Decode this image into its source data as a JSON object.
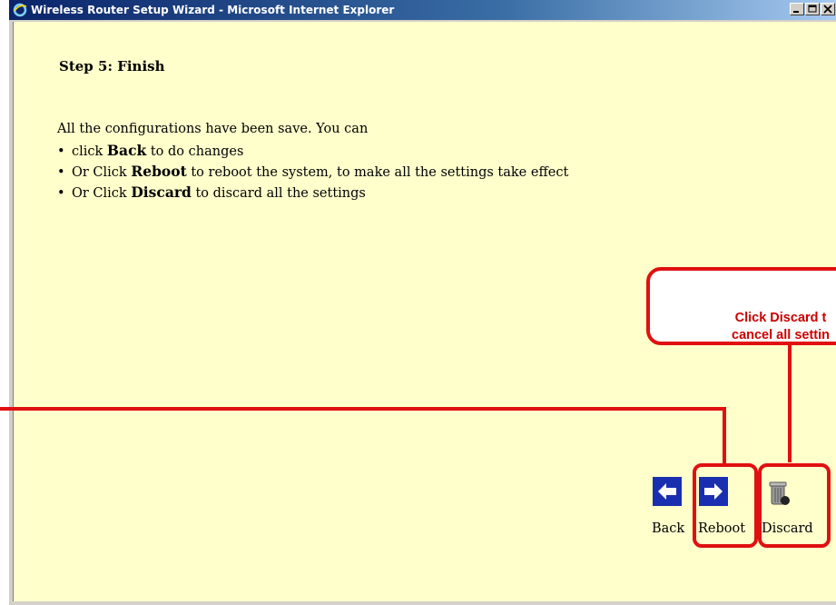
{
  "window": {
    "title": "Wireless Router Setup Wizard - Microsoft Internet Explorer"
  },
  "page": {
    "step_title": "Step 5: Finish",
    "intro": "All the configurations have been save. You can",
    "bullets": [
      {
        "pre": "click ",
        "bold": "Back",
        "post": " to do changes"
      },
      {
        "pre": "Or Click ",
        "bold": "Reboot",
        "post": " to reboot the system, to make all the settings take effect"
      },
      {
        "pre": "Or Click ",
        "bold": "Discard",
        "post": " to discard all the settings"
      }
    ]
  },
  "buttons": {
    "back": "Back",
    "reboot": "Reboot",
    "discard": "Discard"
  },
  "callout": {
    "line1": "Click Discard t",
    "line2": "cancel all settin"
  },
  "colors": {
    "annotation": "#e01010",
    "background": "#ffffcc",
    "button": "#1a2fb0"
  }
}
